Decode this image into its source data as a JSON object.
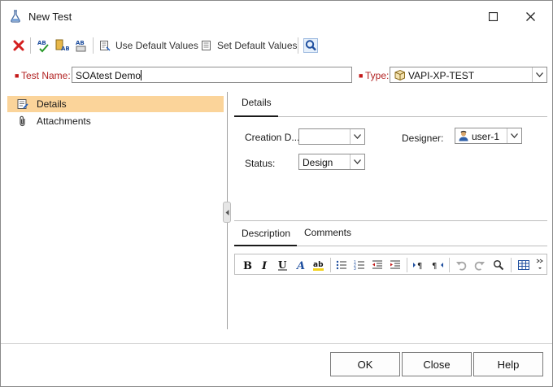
{
  "window": {
    "title": "New Test"
  },
  "toolbar": {
    "use_default_label": "Use Default Values",
    "set_default_label": "Set Default Values"
  },
  "form": {
    "test_name_label": "Test Name:",
    "test_name_value": "SOAtest Demo",
    "type_label": "Type:",
    "type_value": "VAPI-XP-TEST"
  },
  "nav": {
    "items": [
      {
        "label": "Details",
        "icon": "details-icon",
        "selected": true
      },
      {
        "label": "Attachments",
        "icon": "paperclip-icon",
        "selected": false
      }
    ]
  },
  "details": {
    "tab_label": "Details",
    "creation_date_label": "Creation D...",
    "creation_date_value": "",
    "designer_label": "Designer:",
    "designer_value": "user-1",
    "status_label": "Status:",
    "status_value": "Design"
  },
  "lower_tabs": [
    {
      "label": "Description",
      "active": true
    },
    {
      "label": "Comments",
      "active": false
    }
  ],
  "buttons": {
    "ok": "OK",
    "close": "Close",
    "help": "Help"
  },
  "colors": {
    "selection": "#fbd49a",
    "required": "#c41a1a",
    "accent": "#1f5fbf"
  }
}
